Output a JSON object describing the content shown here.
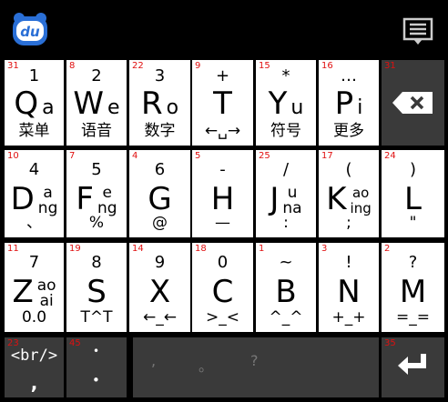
{
  "keyboard": {
    "rows": [
      {
        "keys": [
          {
            "number": "31",
            "digit": "1",
            "letter": "Q",
            "hint": "a",
            "sub": "菜单"
          },
          {
            "number": "8",
            "digit": "2",
            "letter": "W",
            "hint": "e",
            "sub": "语音"
          },
          {
            "number": "22",
            "digit": "3",
            "letter": "R",
            "hint": "o",
            "sub": "数字"
          },
          {
            "number": "9",
            "digit": "+",
            "letter": "T",
            "hint": "",
            "sub": "←␣→"
          },
          {
            "number": "15",
            "digit": "*",
            "letter": "Y",
            "hint": "u",
            "sub": "符号"
          },
          {
            "number": "16",
            "digit": "…",
            "letter": "P",
            "hint": "i",
            "sub": "更多"
          }
        ]
      },
      {
        "keys": [
          {
            "number": "10",
            "digit": "4",
            "letter": "D",
            "hint_top": "a",
            "hint_bottom": "ng",
            "sub": "、"
          },
          {
            "number": "7",
            "digit": "5",
            "letter": "F",
            "hint_top": "e",
            "hint_bottom": "ng",
            "sub": "%"
          },
          {
            "number": "4",
            "digit": "6",
            "letter": "G",
            "hint_top": "",
            "hint_bottom": "",
            "sub": "@"
          },
          {
            "number": "5",
            "digit": "-",
            "letter": "H",
            "hint_top": "",
            "hint_bottom": "",
            "sub": "—"
          },
          {
            "number": "25",
            "digit": "/",
            "letter": "J",
            "hint_top": "u",
            "hint_bottom": "na",
            "sub": ":"
          },
          {
            "number": "17",
            "digit": "(",
            "letter": "K",
            "hint_top": "ao",
            "hint_bottom": "ing",
            "sub": ";"
          },
          {
            "number": "24",
            "digit": ")",
            "letter": "L",
            "hint_top": "",
            "hint_bottom": "",
            "sub": "\""
          }
        ]
      },
      {
        "keys": [
          {
            "number": "11",
            "digit": "7",
            "letter": "Z",
            "hint_top": "ao",
            "hint_bottom": "ai",
            "sub": "0.0"
          },
          {
            "number": "19",
            "digit": "8",
            "letter": "S",
            "hint_top": "",
            "hint_bottom": "",
            "sub": "T^T"
          },
          {
            "number": "14",
            "digit": "9",
            "letter": "X",
            "hint_top": "",
            "hint_bottom": "",
            "sub": "←_←"
          },
          {
            "number": "18",
            "digit": "0",
            "letter": "C",
            "hint_top": "",
            "hint_bottom": "",
            "sub": ">_<"
          },
          {
            "number": "1",
            "digit": "~",
            "letter": "B",
            "hint_top": "",
            "hint_bottom": "",
            "sub": "^_^"
          },
          {
            "number": "3",
            "digit": "!",
            "letter": "N",
            "hint_top": "",
            "hint_bottom": "",
            "sub": "+_+"
          },
          {
            "number": "2",
            "digit": "?",
            "letter": "M",
            "hint_top": "",
            "hint_bottom": "",
            "sub": "=_="
          }
        ]
      }
    ],
    "backspace": {
      "number": "31"
    },
    "bottom": {
      "tag": {
        "number": "23",
        "label": "<br/>",
        "sub": ","
      },
      "dots": {
        "number": "45",
        "top": "•",
        "bottom": "•"
      },
      "space": {
        "marks": [
          ",",
          "。",
          "?"
        ]
      },
      "enter": {
        "number": "35"
      }
    }
  },
  "toolbar": {
    "logo_text": "du"
  },
  "colors": {
    "key_bg": "#ffffff",
    "dark_key_bg": "#3a3a3a",
    "number_color": "#e01010",
    "logo_blue": "#2a6fd6"
  }
}
